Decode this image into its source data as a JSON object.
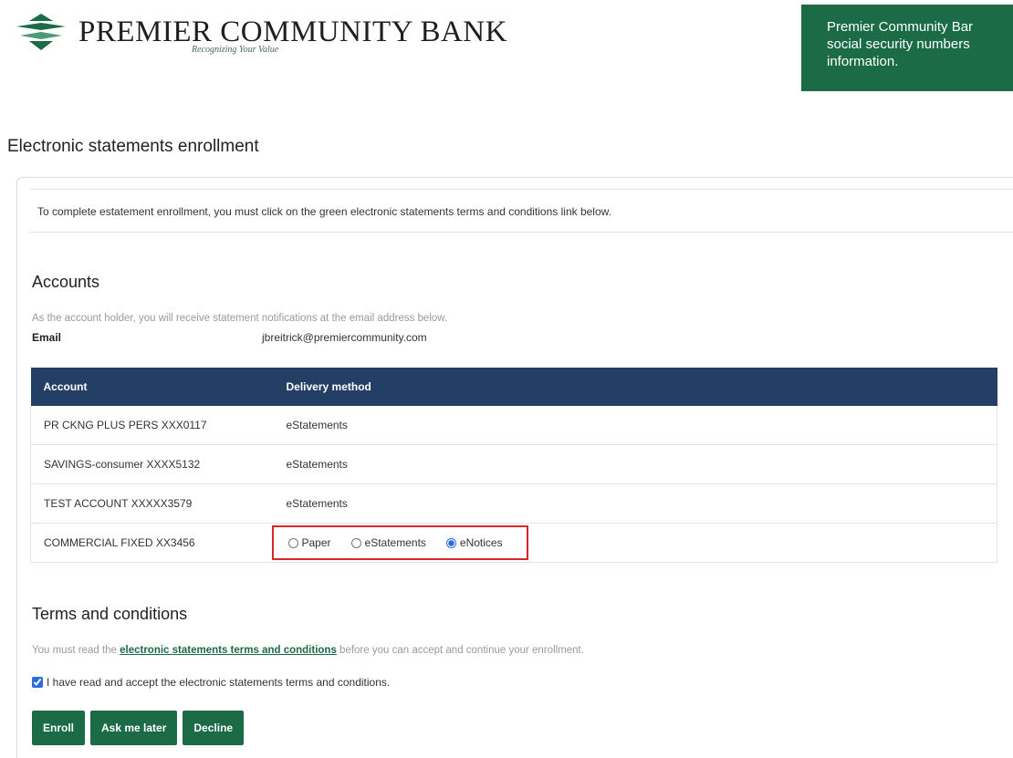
{
  "header": {
    "bank_name": "PREMIER COMMUNITY BANK",
    "tagline": "Recognizing Your Value",
    "notice": "Premier Community Bar\nsocial security numbers\ninformation."
  },
  "page_title": "Electronic statements enrollment",
  "instruction": "To complete estatement enrollment, you must click on the green electronic statements terms and conditions link below.",
  "accounts": {
    "heading": "Accounts",
    "helper": "As the account holder, you will receive statement notifications at the email address below.",
    "email_label": "Email",
    "email_value": "jbreitrick@premiercommunity.com",
    "columns": {
      "account": "Account",
      "delivery": "Delivery method"
    },
    "rows": [
      {
        "account": "PR CKNG PLUS PERS XXX0117",
        "delivery": "eStatements"
      },
      {
        "account": "SAVINGS-consumer XXXX5132",
        "delivery": "eStatements"
      },
      {
        "account": "TEST ACCOUNT XXXXX3579",
        "delivery": "eStatements"
      },
      {
        "account": "COMMERCIAL FIXED XX3456",
        "delivery_options": [
          "Paper",
          "eStatements",
          "eNotices"
        ],
        "selected": "eNotices"
      }
    ]
  },
  "terms": {
    "heading": "Terms and conditions",
    "helper_pre": "You must read the ",
    "link_text": "electronic statements terms and conditions",
    "helper_post": " before you can accept and continue your enrollment.",
    "checkbox_label": "I have read and accept the electronic statements terms and conditions.",
    "checked": true
  },
  "buttons": {
    "enroll": "Enroll",
    "ask_later": "Ask me later",
    "decline": "Decline"
  },
  "colors": {
    "brand_green": "#1b6b46",
    "table_header": "#233f66",
    "highlight_border": "#d9262c"
  }
}
